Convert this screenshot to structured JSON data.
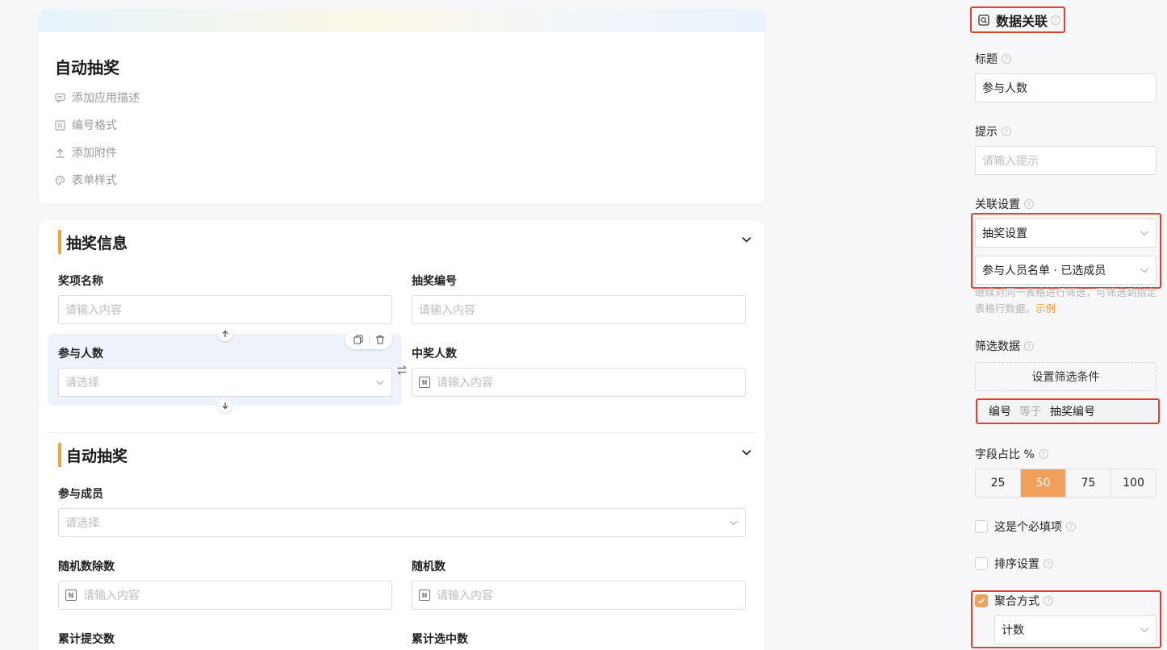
{
  "app": {
    "title": "自动抽奖",
    "meta": [
      "添加应用描述",
      "编号格式",
      "添加附件",
      "表单样式"
    ]
  },
  "sections": [
    {
      "title": "抽奖信息",
      "fields": [
        {
          "label": "奖项名称",
          "placeholder": "请输入内容"
        },
        {
          "label": "抽奖编号",
          "placeholder": "请输入内容"
        },
        {
          "label": "参与人数",
          "placeholder": "请选择"
        },
        {
          "label": "中奖人数",
          "placeholder": "请输入内容"
        }
      ]
    },
    {
      "title": "自动抽奖",
      "fields": [
        {
          "label": "参与成员",
          "placeholder": "请选择"
        },
        {
          "label": "随机数除数",
          "placeholder": "请输入内容"
        },
        {
          "label": "随机数",
          "placeholder": "请输入内容"
        },
        {
          "label": "累计提交数"
        },
        {
          "label": "累计选中数"
        }
      ]
    }
  ],
  "panel": {
    "header": "数据关联",
    "title_label": "标题",
    "title_value": "参与人数",
    "hint_label": "提示",
    "hint_placeholder": "请输入提示",
    "assoc_label": "关联设置",
    "assoc_table": "抽奖设置",
    "assoc_field": "参与人员名单 · 已选成员",
    "assoc_hint": "继续对同一表格进行筛选，可筛选到指定表格行数据。",
    "assoc_link": "示例",
    "filter_label": "筛选数据",
    "filter_button": "设置筛选条件",
    "condition": {
      "field": "编号",
      "op": "等于",
      "value": "抽奖编号"
    },
    "ratio_label": "字段占比 %",
    "ratio_options": [
      "25",
      "50",
      "75",
      "100"
    ],
    "ratio_selected": "50",
    "required_label": "这是个必填项",
    "required_checked": false,
    "sort_label": "排序设置",
    "sort_checked": false,
    "agg_label": "聚合方式",
    "agg_checked": true,
    "agg_value": "计数"
  },
  "colors": {
    "accent": "#f0a05a",
    "section_bar": "#f0a33a",
    "highlight": "#e0412c",
    "selected_bg": "#eef3fb"
  }
}
